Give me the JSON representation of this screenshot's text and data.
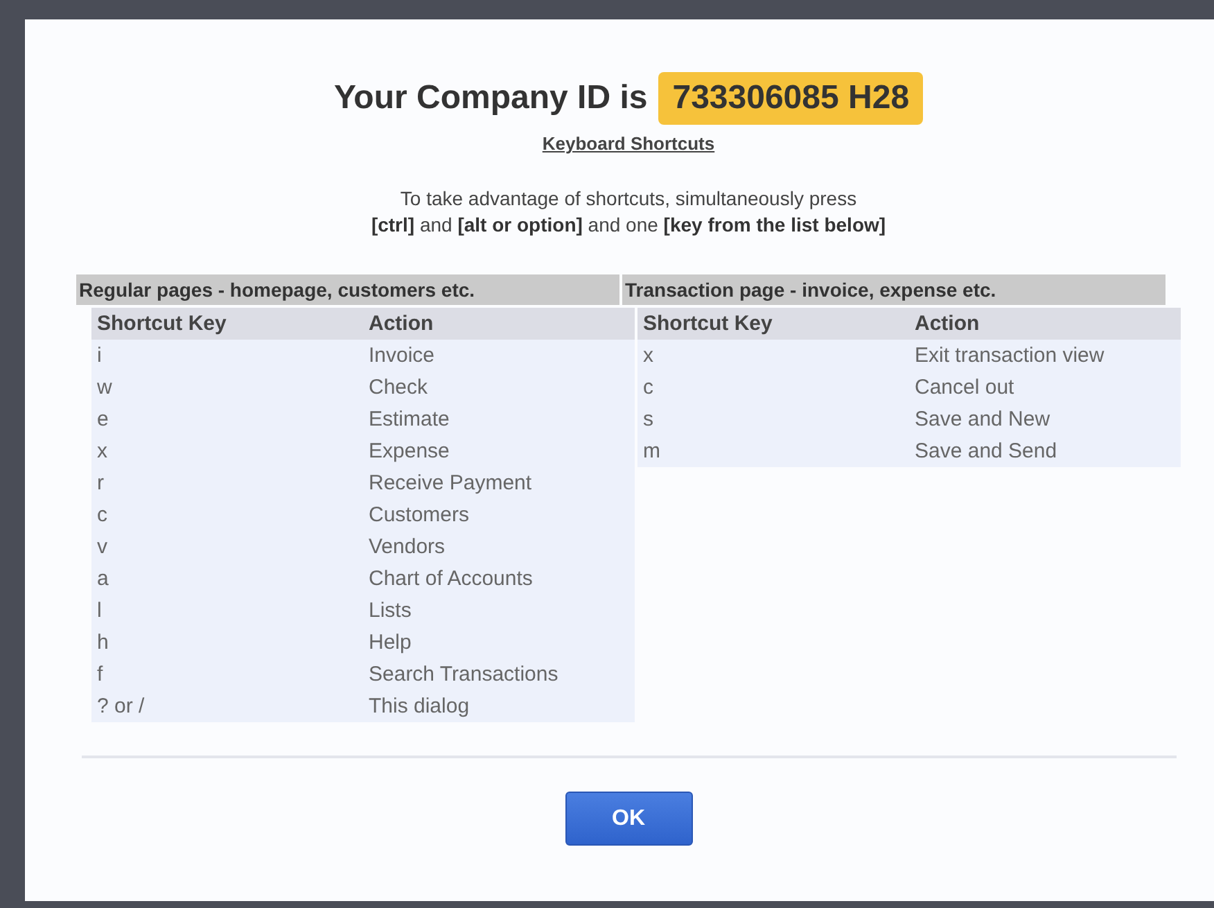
{
  "dialog": {
    "title": "Your Company ID is",
    "company_id": "733306085 H28",
    "link": "Keyboard Shortcuts",
    "instructions": [
      "To take advantage of shortcuts, simultaneously press",
      "**[ctrl]** and **[alt or option]** and one **[key from the list below]**"
    ],
    "sections": [
      {
        "heading": "Regular pages - homepage, customers etc.",
        "columns": [
          "Shortcut Key",
          "Action"
        ],
        "rows": [
          {
            "key": "i",
            "action": "Invoice"
          },
          {
            "key": "w",
            "action": "Check"
          },
          {
            "key": "e",
            "action": "Estimate"
          },
          {
            "key": "x",
            "action": "Expense"
          },
          {
            "key": "r",
            "action": "Receive Payment"
          },
          {
            "key": "c",
            "action": "Customers"
          },
          {
            "key": "v",
            "action": "Vendors"
          },
          {
            "key": "a",
            "action": "Chart of Accounts"
          },
          {
            "key": "l",
            "action": "Lists"
          },
          {
            "key": "h",
            "action": "Help"
          },
          {
            "key": "f",
            "action": "Search Transactions"
          },
          {
            "key": "? or /",
            "action": "This dialog"
          }
        ]
      },
      {
        "heading": "Transaction page - invoice, expense etc.",
        "columns": [
          "Shortcut Key",
          "Action"
        ],
        "rows": [
          {
            "key": "x",
            "action": "Exit transaction view"
          },
          {
            "key": "c",
            "action": "Cancel out"
          },
          {
            "key": "s",
            "action": "Save and New"
          },
          {
            "key": "m",
            "action": "Save and Send"
          }
        ]
      }
    ],
    "buttons": [
      "OK"
    ]
  }
}
